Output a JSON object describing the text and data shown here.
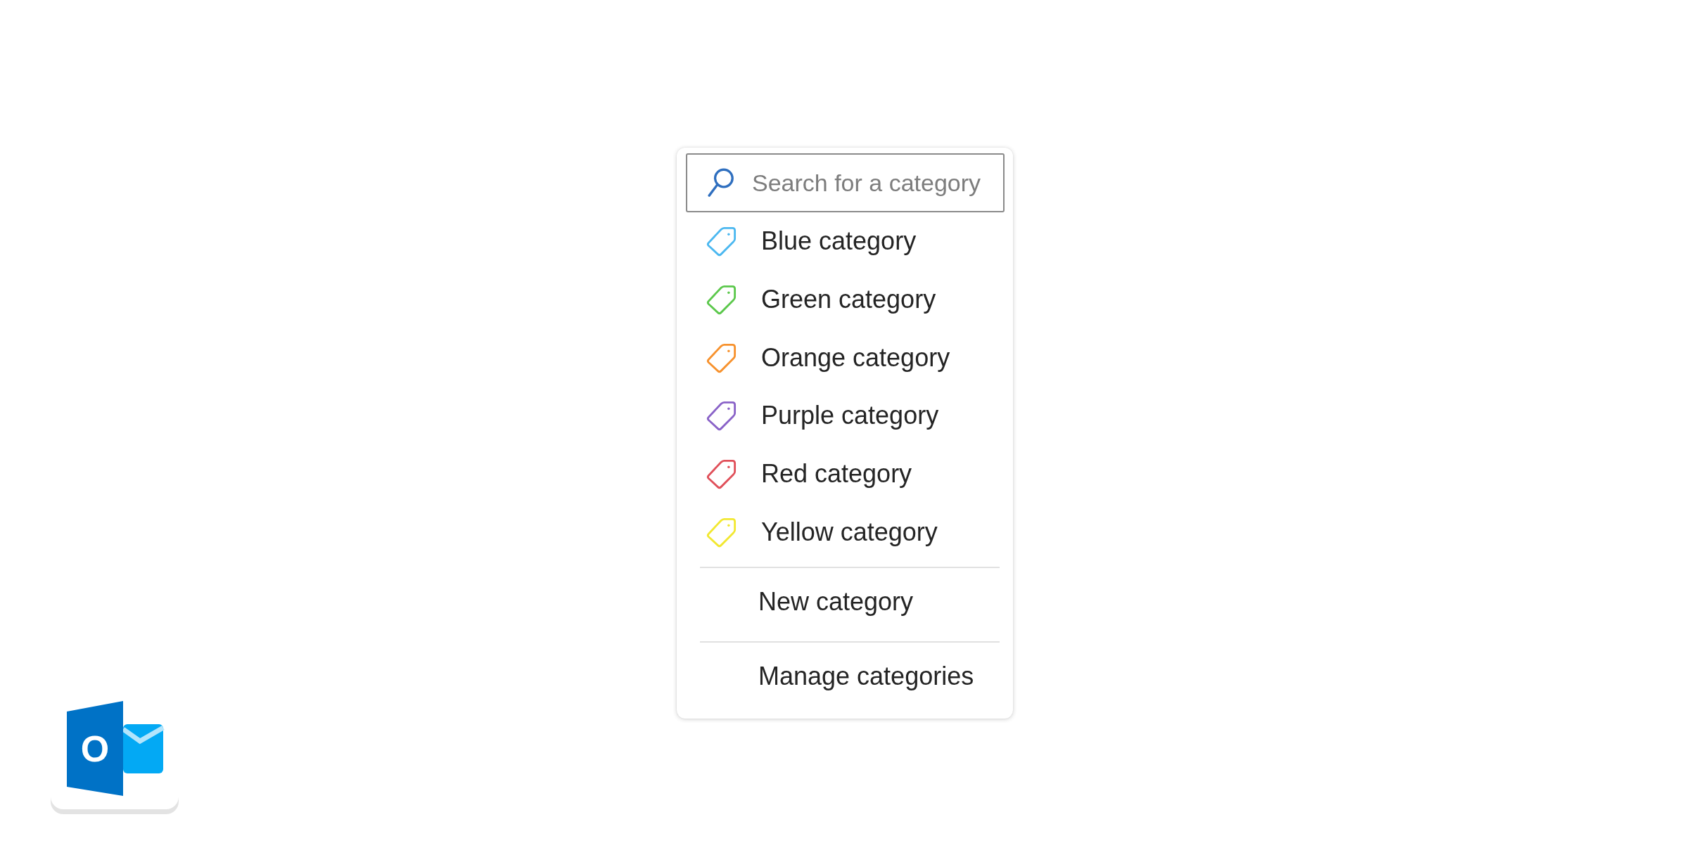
{
  "search": {
    "placeholder": "Search for a category"
  },
  "categories": [
    {
      "label": "Blue category",
      "color": "#4cb8f0"
    },
    {
      "label": "Green category",
      "color": "#5cc84c"
    },
    {
      "label": "Orange category",
      "color": "#f7922e"
    },
    {
      "label": "Purple category",
      "color": "#8a63c8"
    },
    {
      "label": "Red category",
      "color": "#e0505a"
    },
    {
      "label": "Yellow category",
      "color": "#f2e832"
    }
  ],
  "actions": [
    "New category",
    "Manage categories"
  ],
  "logo": {
    "letter": "O"
  }
}
